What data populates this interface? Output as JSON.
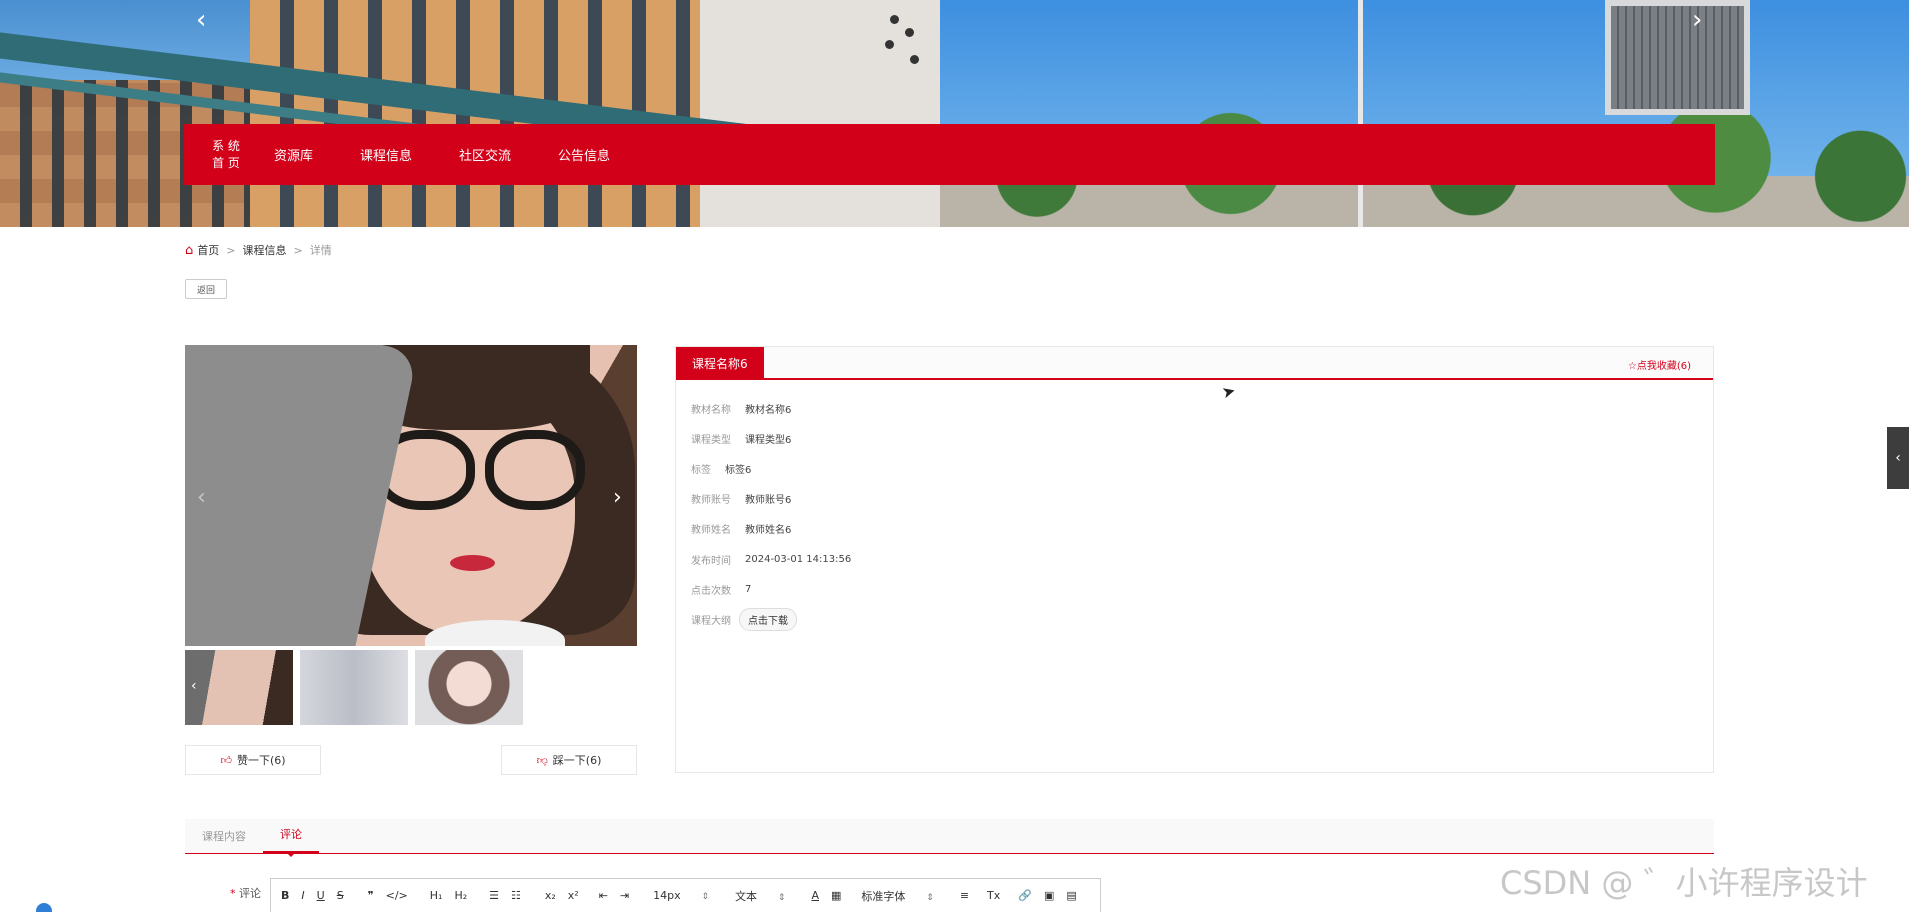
{
  "nav": {
    "logo_line1": "系 统",
    "logo_line2": "首 页",
    "items": [
      "资源库",
      "课程信息",
      "社区交流",
      "公告信息"
    ]
  },
  "breadcrumb": {
    "home": "首页",
    "section": "课程信息",
    "current": "详情",
    "separator": ">"
  },
  "back_label": "返回",
  "detail": {
    "title": "课程名称6",
    "favorite": "☆点我收藏(6)",
    "fields": [
      {
        "label": "教材名称",
        "value": "教材名称6"
      },
      {
        "label": "课程类型",
        "value": "课程类型6"
      },
      {
        "label": "标签",
        "value": "标签6"
      },
      {
        "label": "教师账号",
        "value": "教师账号6"
      },
      {
        "label": "教师姓名",
        "value": "教师姓名6"
      },
      {
        "label": "发布时间",
        "value": "2024-03-01 14:13:56"
      },
      {
        "label": "点击次数",
        "value": "7"
      },
      {
        "label": "课程大纲",
        "value": "点击下载"
      }
    ]
  },
  "votes": {
    "like": "赞一下(6)",
    "dislike": "踩一下(6)"
  },
  "tabs": [
    {
      "label": "课程内容",
      "active": false
    },
    {
      "label": "评论",
      "active": true
    }
  ],
  "editor": {
    "required_mark": "*",
    "label": "评论",
    "toolbar": [
      "B",
      "I",
      "U",
      "S",
      "❞",
      "</>",
      "H₁",
      "H₂",
      "☰",
      "☷",
      "x₂",
      "x²",
      "⇤",
      "⇥"
    ],
    "font_size": "14px",
    "text_type": "文本",
    "font_family": "标准字体",
    "toolbar_tail": [
      "A",
      "▦",
      "≡",
      "Tx",
      "🔗",
      "▣",
      "▤"
    ]
  },
  "watermark": "CSDN @ ゛小许程序设计",
  "colors": {
    "accent": "#d3001a"
  }
}
